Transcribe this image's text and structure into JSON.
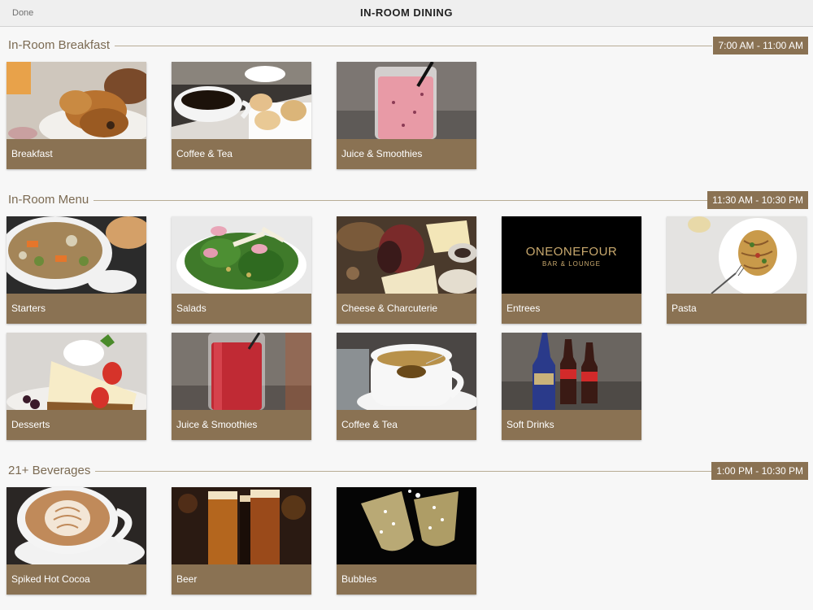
{
  "header": {
    "done_label": "Done",
    "title": "IN-ROOM DINING"
  },
  "sections": [
    {
      "title": "In-Room Breakfast",
      "hours": "7:00 AM - 11:00 AM",
      "items": [
        {
          "label": "Breakfast",
          "photo": "pastries-photo"
        },
        {
          "label": "Coffee & Tea",
          "photo": "coffee-cup-photo"
        },
        {
          "label": "Juice & Smoothies",
          "photo": "smoothie-photo"
        }
      ]
    },
    {
      "title": "In-Room Menu",
      "hours": "11:30 AM - 10:30 PM",
      "items": [
        {
          "label": "Starters",
          "photo": "soup-photo"
        },
        {
          "label": "Salads",
          "photo": "salad-photo"
        },
        {
          "label": "Cheese & Charcuterie",
          "photo": "cheese-board-photo"
        },
        {
          "label": "Entrees",
          "photo": "oneonefour-logo-photo",
          "logo_line1": "ONEONEFOUR",
          "logo_line2": "BAR & LOUNGE"
        },
        {
          "label": "Pasta",
          "photo": "pasta-photo"
        },
        {
          "label": "Desserts",
          "photo": "cheesecake-photo"
        },
        {
          "label": "Juice & Smoothies",
          "photo": "red-juice-photo"
        },
        {
          "label": "Coffee & Tea",
          "photo": "tea-cup-photo"
        },
        {
          "label": "Soft Drinks",
          "photo": "soda-bottles-photo"
        }
      ]
    },
    {
      "title": "21+ Beverages",
      "hours": "1:00 PM - 10:30 PM",
      "items": [
        {
          "label": "Spiked Hot Cocoa",
          "photo": "latte-art-photo"
        },
        {
          "label": "Beer",
          "photo": "beer-glasses-photo"
        },
        {
          "label": "Bubbles",
          "photo": "champagne-photo"
        }
      ]
    }
  ],
  "colors": {
    "accent": "#8a7253",
    "section_text": "#7b6a52",
    "background": "#f7f7f7"
  }
}
